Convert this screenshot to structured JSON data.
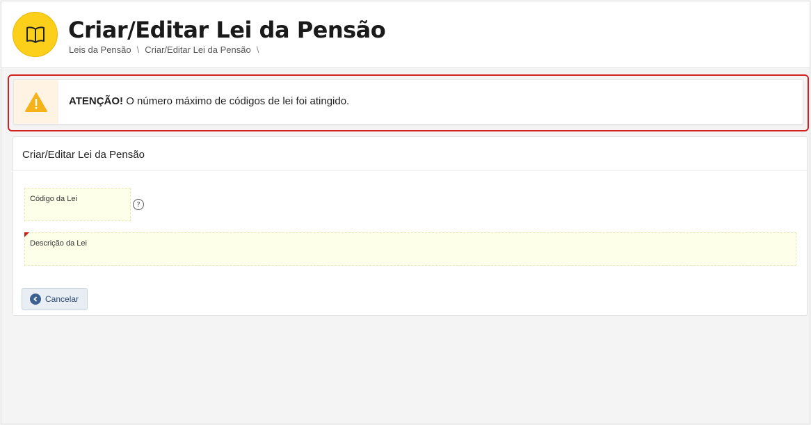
{
  "header": {
    "title": "Criar/Editar Lei da Pensão",
    "icon": "open-book-icon",
    "breadcrumb": [
      "Leis da Pensão",
      "Criar/Editar Lei da Pensão"
    ],
    "breadcrumb_separator": "\\"
  },
  "alert": {
    "icon": "warning-icon",
    "strong": "ATENÇÃO!",
    "message": " O número máximo de códigos de lei foi atingido."
  },
  "form": {
    "title": "Criar/Editar Lei da Pensão",
    "code_label": "Código da Lei",
    "code_value": "",
    "help_glyph": "?",
    "description_label": "Descrição da Lei",
    "description_value": "",
    "cancel_label": "Cancelar"
  },
  "colors": {
    "logo": "#fccf1b",
    "alert_outline": "#d42020",
    "alert_icon": "#f5b21b",
    "field_bg": "#fdffe8",
    "cancel_bg": "#e9eef5"
  }
}
